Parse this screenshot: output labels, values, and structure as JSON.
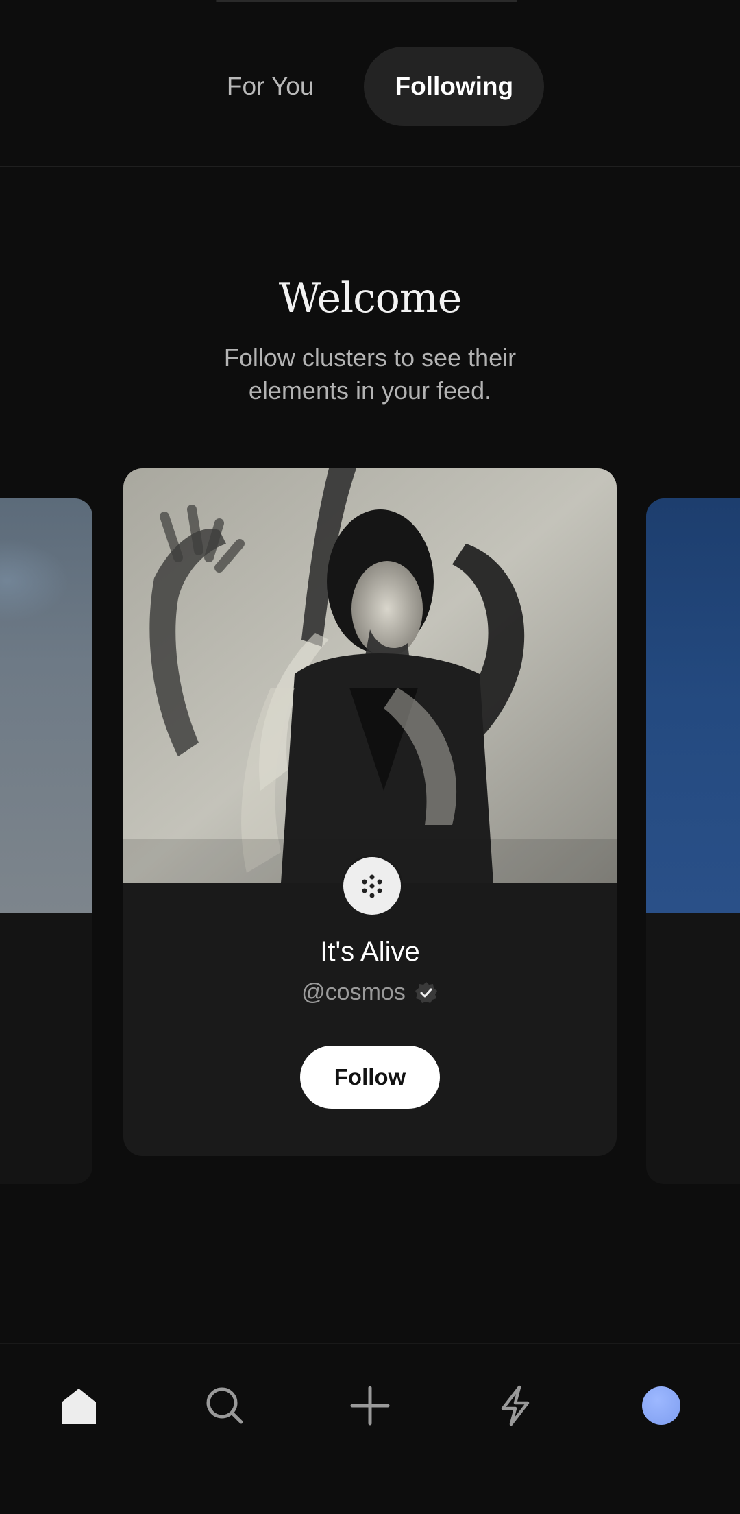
{
  "tabs": [
    {
      "label": "For You",
      "active": false
    },
    {
      "label": "Following",
      "active": true
    }
  ],
  "welcome": {
    "title": "Welcome",
    "subtitle": "Follow clusters to see their elements in your feed."
  },
  "featured_card": {
    "title": "It's Alive",
    "handle": "@cosmos",
    "verified": true,
    "follow_label": "Follow",
    "avatar_icon": "cosmos-dots-icon"
  },
  "bottom_nav": [
    {
      "icon": "home-icon",
      "active": true
    },
    {
      "icon": "search-icon",
      "active": false
    },
    {
      "icon": "plus-icon",
      "active": false
    },
    {
      "icon": "lightning-icon",
      "active": false
    },
    {
      "icon": "profile-avatar",
      "active": false
    }
  ],
  "colors": {
    "background": "#0d0d0d",
    "card": "#1a1a1a",
    "active_tab": "#232323",
    "profile_accent": "#8aa8f8"
  }
}
